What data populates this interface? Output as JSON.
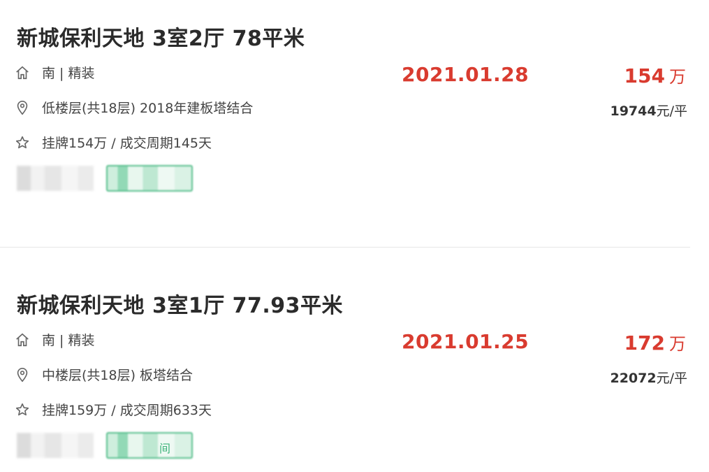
{
  "listings": [
    {
      "title": "新城保利天地 3室2厅 78平米",
      "orientation_decor": "南 | 精装",
      "floor_info": "低楼层(共18层) 2018年建板塔结合",
      "listing_info": "挂牌154万 / 成交周期145天",
      "deal_date": "2021.01.28",
      "total_price": "154",
      "total_unit": "万",
      "unit_price": "19744",
      "unit_price_suffix": "元/平"
    },
    {
      "title": "新城保利天地 3室1厅 77.93平米",
      "orientation_decor": "南 | 精装",
      "floor_info": "中楼层(共18层) 板塔结合",
      "listing_info": "挂牌159万 / 成交周期633天",
      "deal_date": "2021.01.25",
      "total_price": "172",
      "total_unit": "万",
      "unit_price": "22072",
      "unit_price_suffix": "元/平",
      "partial_tag_char": "间"
    }
  ],
  "icons": [
    "house-icon",
    "location-pin-icon",
    "star-icon"
  ],
  "colors": {
    "price_red": "#d93b2f",
    "tag_green": "#3cb37a",
    "text": "#333333"
  }
}
